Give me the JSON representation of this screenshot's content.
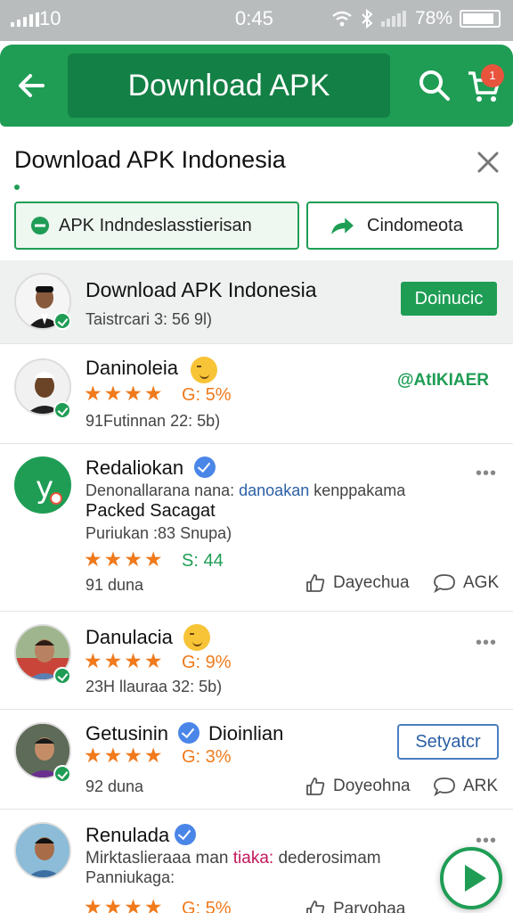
{
  "status_bar": {
    "carrier": "10",
    "time": "0:45",
    "battery": "78%"
  },
  "app_bar": {
    "title": "Download APK",
    "cart_badge": "1"
  },
  "page": {
    "title": "Download APK Indonesia"
  },
  "chips": [
    {
      "label": "APK Indndeslasstierisan"
    },
    {
      "label": "Cindomeota"
    }
  ],
  "featured": {
    "name": "Download APK Indonesia",
    "meta": "Taistrcari 3: 56 9l)",
    "button": "Doinucic"
  },
  "posts": [
    {
      "name": "Daninoleia",
      "stars": "★★★★",
      "rating": "G: 5%",
      "meta": "91Futinnan 22: 5b)",
      "tag": "@AtIKIAER"
    },
    {
      "name": "Redaliokan",
      "avatar_letter": "y",
      "desc_prefix": "Denonallarana nana: ",
      "desc_link": "danoakan",
      "desc_suffix": " kenppakama",
      "bold": "Packed Sacagat",
      "meta": "Puriukan :83 Snupa)",
      "stars": "★★★★",
      "rating": "S: 44",
      "time": "91 duna",
      "like": "Dayechua",
      "comment": "AGK"
    },
    {
      "name": "Danulacia",
      "stars": "★★★★",
      "rating": "G: 9%",
      "meta": "23H llauraa 32: 5b)"
    },
    {
      "name": "Getusinin",
      "name2": "Dioinlian",
      "stars": "★★★★",
      "rating": "G: 3%",
      "time": "92 duna",
      "button": "Setyatcr",
      "like": "Doyeohna",
      "comment": "ARK"
    },
    {
      "name": "Renulada",
      "desc_prefix": "Mirktaslieraaa man ",
      "desc_link": "tiaka:",
      "desc_suffix": " dederosimam",
      "meta": "Panniukaga:",
      "stars": "★★★★",
      "rating": "G: 5%",
      "like": "Parvohaa",
      "comment": "ARK"
    }
  ],
  "colors": {
    "primary": "#1f9d55",
    "primary_dark": "#138045",
    "star": "#f07a1c",
    "link": "#2b5fa5",
    "badge": "#e8543c"
  }
}
